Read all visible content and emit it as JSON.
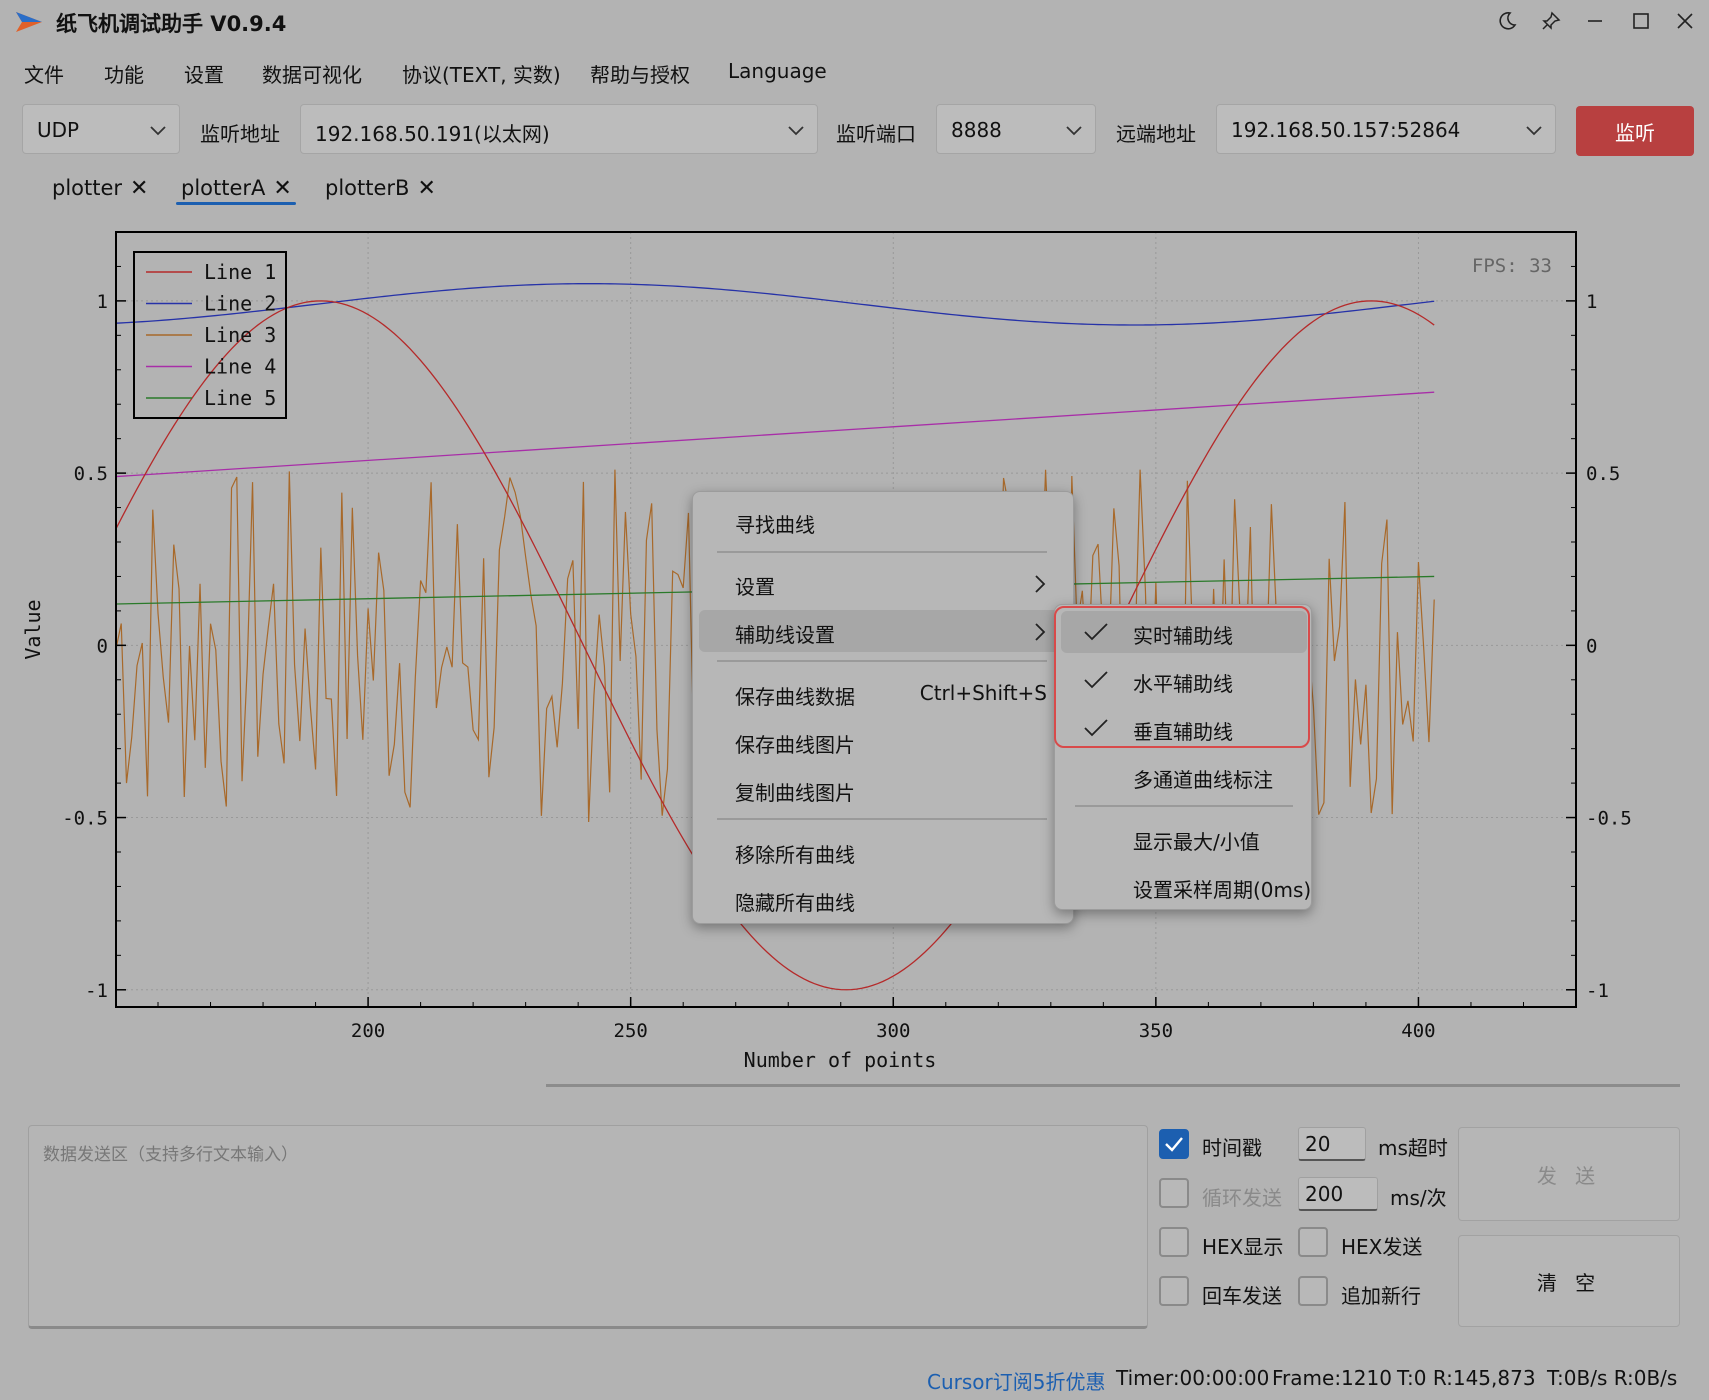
{
  "titlebar": {
    "title": "纸飞机调试助手 V0.9.4"
  },
  "menu": [
    "文件",
    "功能",
    "设置",
    "数据可视化",
    "协议(TEXT, 实数)",
    "帮助与授权",
    "Language"
  ],
  "toolbar": {
    "protocol": "UDP",
    "listen_addr_label": "监听地址",
    "listen_addr": "192.168.50.191(以太网)",
    "listen_port_label": "监听端口",
    "listen_port": "8888",
    "remote_addr_label": "远端地址",
    "remote_addr": "192.168.50.157:52864",
    "listen_button": "监听"
  },
  "tabs": [
    {
      "label": "plotter"
    },
    {
      "label": "plotterA",
      "active": true
    },
    {
      "label": "plotterB"
    }
  ],
  "chart_data": {
    "type": "line",
    "xlabel": "Number of points",
    "ylabel": "Value",
    "fps_label": "FPS: 33",
    "xlim": [
      152,
      430
    ],
    "ylim": [
      -1.05,
      1.2
    ],
    "x_ticks": [
      200,
      250,
      300,
      350,
      400
    ],
    "y_ticks": [
      1,
      0.5,
      0,
      -0.5,
      -1
    ],
    "y_tick_labels": [
      "1",
      "0.5",
      "0",
      "-0.5",
      "-1"
    ],
    "grid": true,
    "legend_position": "top-left",
    "x_range": [
      152,
      403
    ],
    "series": [
      {
        "name": "Line 1",
        "color": "#b52a2a",
        "formula": "sin",
        "amplitude": 1,
        "period": 200,
        "peak_at": 191,
        "x": [
          152,
          191,
          241,
          291,
          341,
          391,
          403
        ],
        "y": [
          0.32,
          1.0,
          0.0,
          -1.0,
          0.0,
          1.0,
          0.93
        ]
      },
      {
        "name": "Line 2",
        "color": "#2632a8",
        "x": [
          152,
          240,
          344,
          403
        ],
        "y": [
          0.93,
          1.05,
          0.93,
          1.03
        ]
      },
      {
        "name": "Line 3",
        "color": "#a8692a",
        "type": "noise",
        "range": [
          -0.52,
          0.52
        ]
      },
      {
        "name": "Line 4",
        "color": "#a82ea8",
        "x": [
          152,
          403
        ],
        "y": [
          0.49,
          0.735
        ]
      },
      {
        "name": "Line 5",
        "color": "#2a7a2a",
        "x": [
          152,
          403
        ],
        "y": [
          0.12,
          0.2
        ]
      }
    ]
  },
  "context_menu": {
    "find_curve": "寻找曲线",
    "settings": "设置",
    "aux_settings": "辅助线设置",
    "save_data": "保存曲线数据",
    "save_data_shortcut": "Ctrl+Shift+S",
    "save_image": "保存曲线图片",
    "copy_image": "复制曲线图片",
    "remove_all": "移除所有曲线",
    "hide_all": "隐藏所有曲线"
  },
  "submenu": {
    "realtime_aux": "实时辅助线",
    "horizontal_aux": "水平辅助线",
    "vertical_aux": "垂直辅助线",
    "multi_channel": "多通道曲线标注",
    "show_minmax": "显示最大/小值",
    "sample_period": "设置采样周期(0ms)"
  },
  "send": {
    "placeholder": "数据发送区（支持多行文本输入）",
    "timestamp": "时间戳",
    "timeout_value": "20",
    "timeout_unit": "ms超时",
    "loop_send": "循环发送",
    "loop_value": "200",
    "loop_unit": "ms/次",
    "hex_display": "HEX显示",
    "hex_send": "HEX发送",
    "enter_send": "回车发送",
    "append_newline": "追加新行",
    "send_button": "发 送",
    "clear_button": "清 空"
  },
  "status": {
    "promo": "Cursor订阅5折优惠",
    "timer": "Timer:00:00:00",
    "frame": "Frame:1210",
    "tr": "T:0 R:145,873",
    "rate": "T:0B/s R:0B/s"
  },
  "colors": {
    "accent": "#1c5fb0",
    "listen_button": "#b84040",
    "highlight_box": "#d84a4a"
  }
}
